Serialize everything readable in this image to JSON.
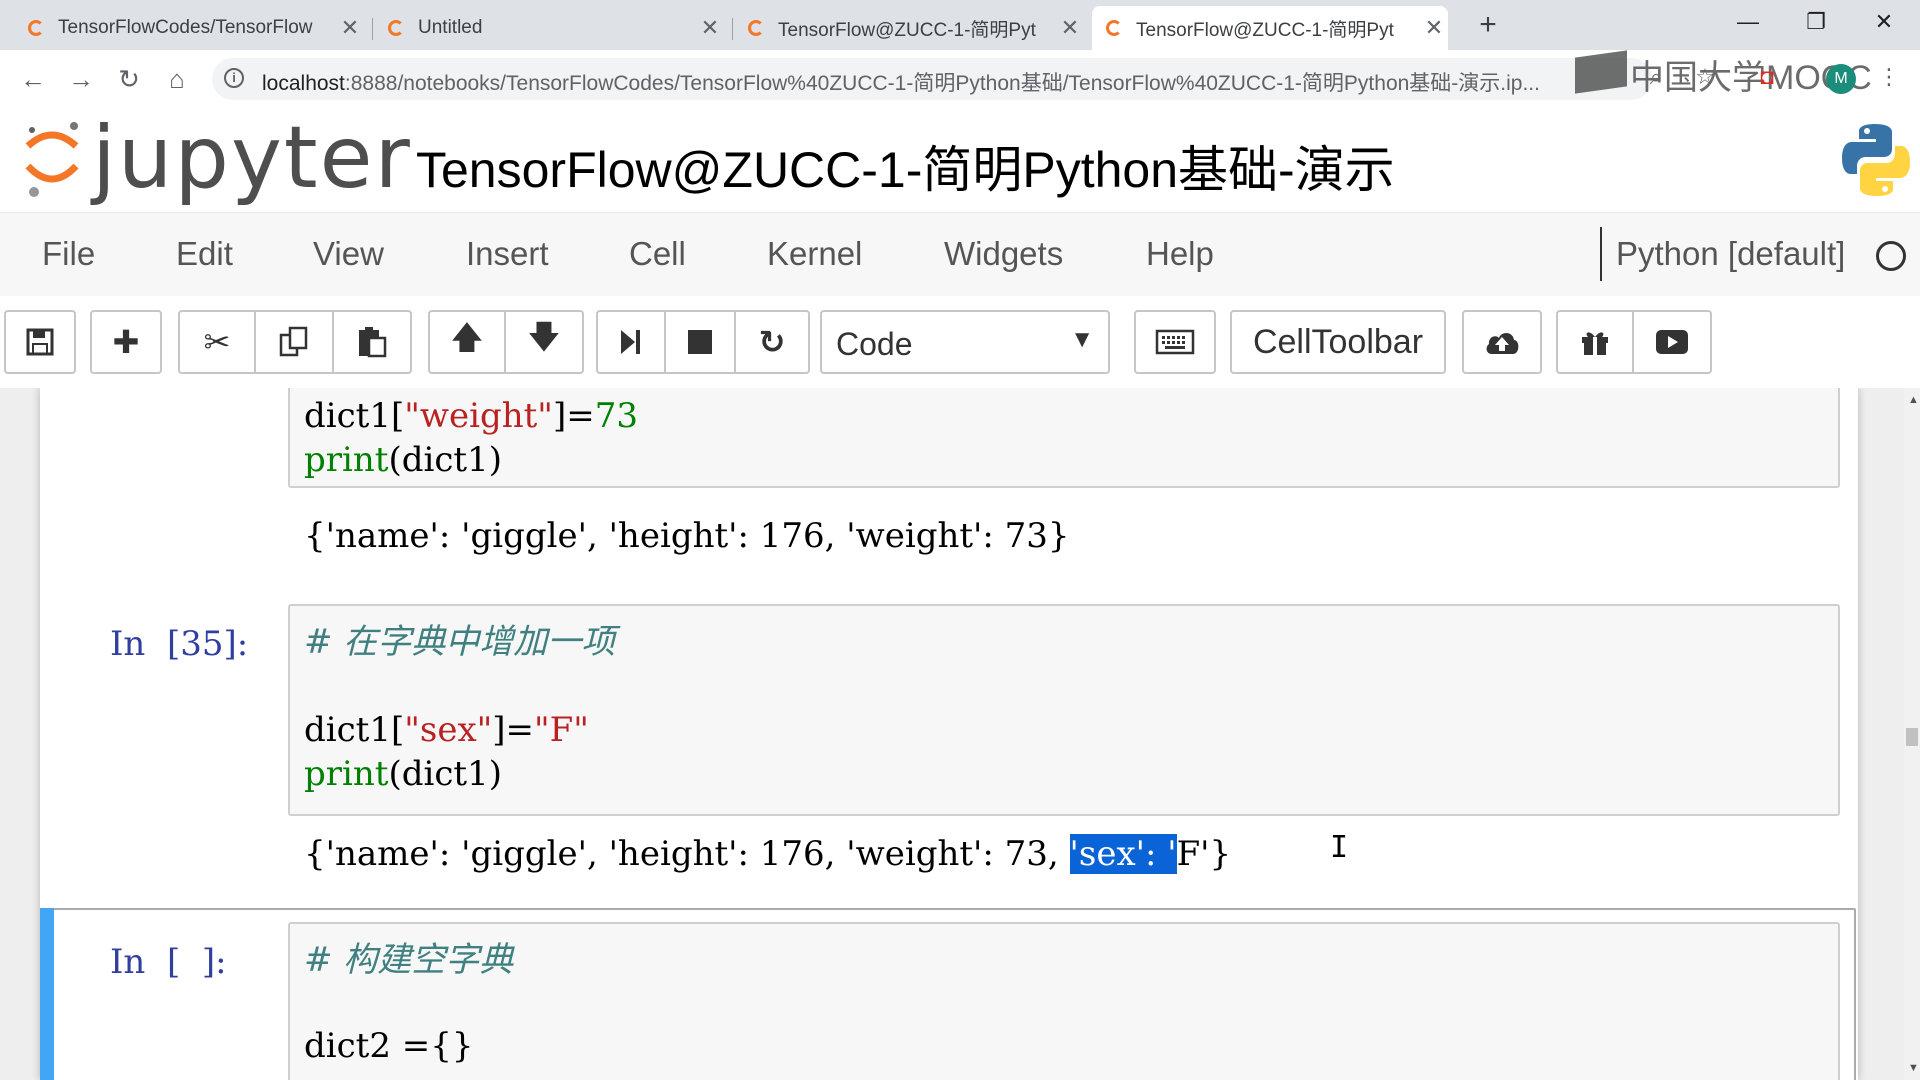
{
  "browser": {
    "tabs": [
      {
        "title": "TensorFlowCodes/TensorFlow",
        "close": "✕"
      },
      {
        "title": "Untitled",
        "close": "✕"
      },
      {
        "title": "TensorFlow@ZUCC-1-简明Pyt",
        "close": "✕"
      },
      {
        "title": "TensorFlow@ZUCC-1-简明Pyt",
        "close": "✕"
      }
    ],
    "new_tab": "+",
    "window_controls": {
      "minimize": "—",
      "restore": "❐",
      "close": "✕"
    },
    "nav": {
      "back": "←",
      "forward": "→",
      "reload": "↻",
      "home": "⌂"
    },
    "url_host": "localhost",
    "url_rest": ":8888/notebooks/TensorFlowCodes/TensorFlow%40ZUCC-1-简明Python基础/TensorFlow%40ZUCC-1-简明Python基础-演示.ip...",
    "watermark": "中国大学MOOC",
    "avatar_letter": "M"
  },
  "jupyter": {
    "logo_text": "jupyter",
    "notebook_title": "TensorFlow@ZUCC-1-简明Python基础-演示",
    "menu": [
      "File",
      "Edit",
      "View",
      "Insert",
      "Cell",
      "Kernel",
      "Widgets",
      "Help"
    ],
    "kernel": "Python [default]",
    "cell_type": "Code",
    "celltoolbar_label": "CellToolbar"
  },
  "cells": {
    "cell1": {
      "line1_pre": "dict1[",
      "line1_str": "\"weight\"",
      "line1_mid": "]=",
      "line1_num": "73",
      "line2_kw": "print",
      "line2_rest": "(dict1)",
      "output": "{'name': 'giggle', 'height': 176, 'weight': 73}"
    },
    "cell2": {
      "prompt": "In  [35]:",
      "comment": "# 在字典中增加一项",
      "line1_pre": "dict1[",
      "line1_str": "\"sex\"",
      "line1_mid": "]=",
      "line1_val": "\"F\"",
      "line2_kw": "print",
      "line2_rest": "(dict1)",
      "output_pre": "{'name': 'giggle', 'height': 176, 'weight': 73, ",
      "output_sel": "'sex': '",
      "output_post": "F'}"
    },
    "cell3": {
      "prompt": "In  [  ]:",
      "comment": "# 构建空字典",
      "line1": "dict2 ={}"
    }
  }
}
